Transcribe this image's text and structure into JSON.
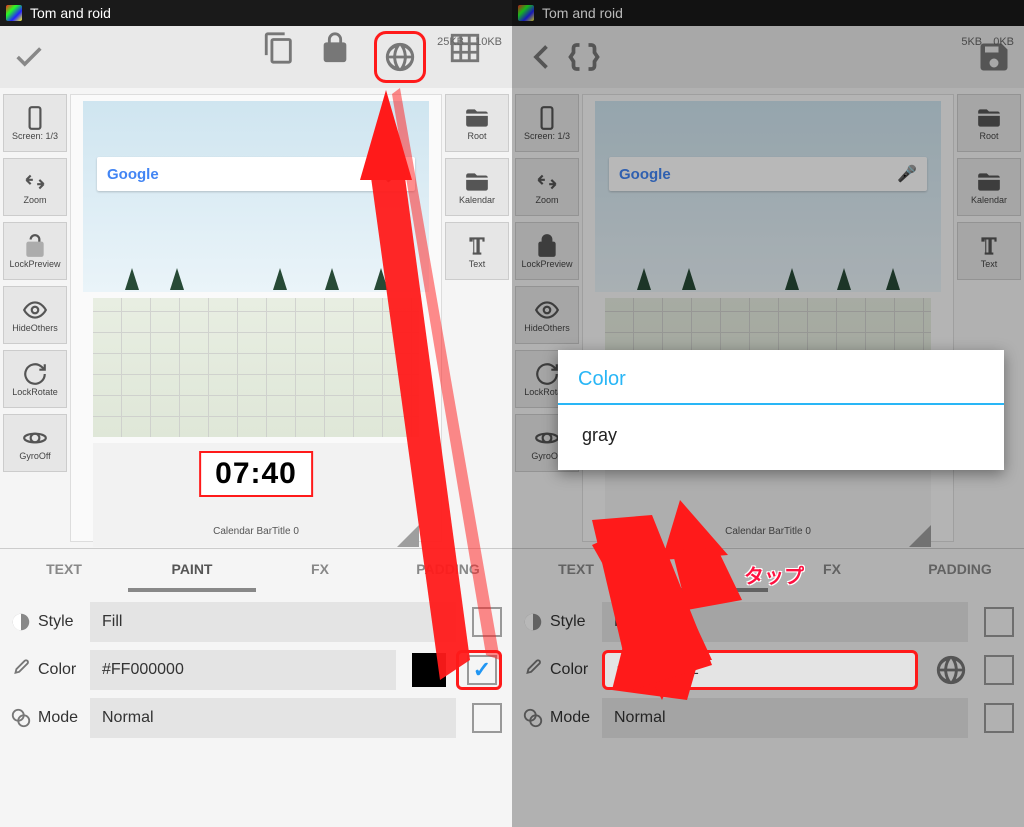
{
  "app_title": "Tom and roid",
  "left": {
    "stats": {
      "a": "25KB",
      "b": "10KB"
    },
    "sidebar": [
      {
        "label": "Screen: 1/3"
      },
      {
        "label": "Zoom"
      },
      {
        "label": "LockPreview"
      },
      {
        "label": "HideOthers"
      },
      {
        "label": "LockRotate"
      },
      {
        "label": "GyroOff"
      }
    ],
    "rsidebar": [
      {
        "label": "Root"
      },
      {
        "label": "Kalendar"
      },
      {
        "label": "Text"
      }
    ],
    "google": "Google",
    "clock": "07:40",
    "caltext": "Calendar BarTitle 0",
    "tabs": [
      "TEXT",
      "PAINT",
      "FX",
      "PADDING"
    ],
    "rows": {
      "style": {
        "label": "Style",
        "value": "Fill"
      },
      "color": {
        "label": "Color",
        "value": "#FF000000"
      },
      "mode": {
        "label": "Mode",
        "value": "Normal"
      }
    }
  },
  "right": {
    "stats": {
      "a": "5KB",
      "b": "0KB"
    },
    "dialog": {
      "title": "Color",
      "input": "gray"
    },
    "tap_label": "タップ",
    "rows": {
      "style": {
        "label": "Style",
        "value": "Fill"
      },
      "color": {
        "label": "Color",
        "value": "#B8323232"
      },
      "mode": {
        "label": "Mode",
        "value": "Normal"
      }
    }
  }
}
